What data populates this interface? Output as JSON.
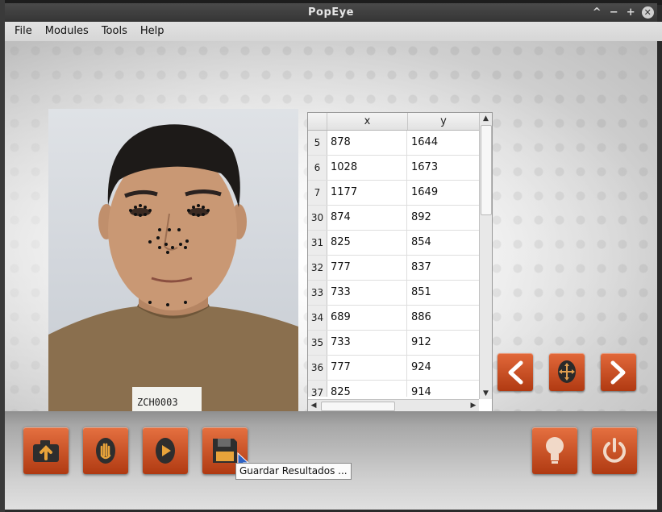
{
  "window": {
    "title": "PopEye",
    "controls": [
      "^",
      "−",
      "+",
      "✕"
    ]
  },
  "menubar": [
    "File",
    "Modules",
    "Tools",
    "Help"
  ],
  "table": {
    "headers": [
      "x",
      "y"
    ],
    "rows": [
      {
        "id": "5",
        "x": "878",
        "y": "1644"
      },
      {
        "id": "6",
        "x": "1028",
        "y": "1673"
      },
      {
        "id": "7",
        "x": "1177",
        "y": "1649"
      },
      {
        "id": "30",
        "x": "874",
        "y": "892"
      },
      {
        "id": "31",
        "x": "825",
        "y": "854"
      },
      {
        "id": "32",
        "x": "777",
        "y": "837"
      },
      {
        "id": "33",
        "x": "733",
        "y": "851"
      },
      {
        "id": "34",
        "x": "689",
        "y": "886"
      },
      {
        "id": "35",
        "x": "733",
        "y": "912"
      },
      {
        "id": "36",
        "x": "777",
        "y": "924"
      },
      {
        "id": "37",
        "x": "825",
        "y": "914"
      }
    ]
  },
  "photo": {
    "label_text": "ZCH0003"
  },
  "nav_buttons": [
    "previous-button",
    "move-landmark-button",
    "next-button"
  ],
  "toolbar": {
    "buttons": [
      "load-image-button",
      "manual-landmark-button",
      "run-detection-button",
      "save-results-button",
      "help-tips-button",
      "power-button"
    ],
    "tooltip": "Guardar Resultados ..."
  },
  "colors": {
    "accent": "#c8501f",
    "background": "#e6e6e6"
  }
}
